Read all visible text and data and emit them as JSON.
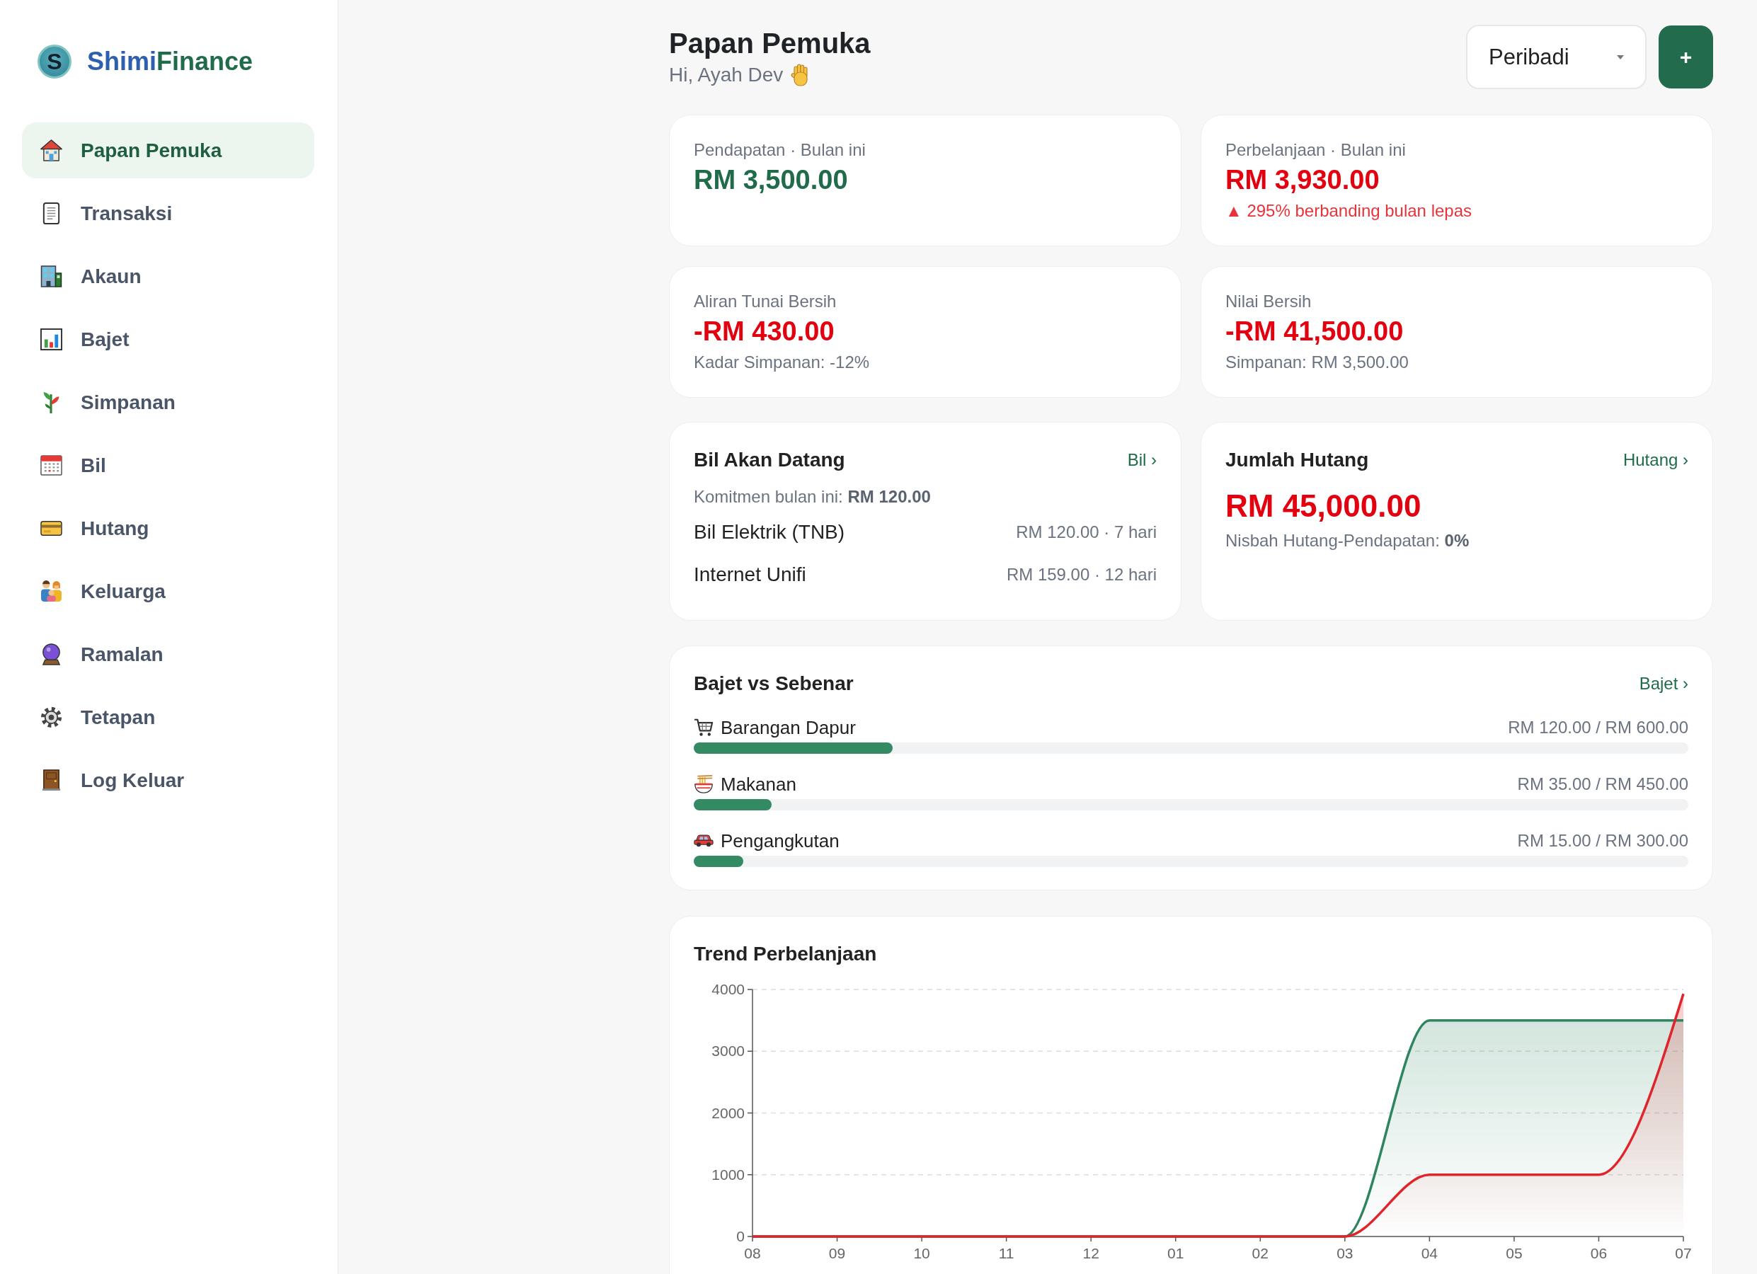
{
  "sidebar": {
    "brand": {
      "mark": "S",
      "name_start": "Shimi",
      "name_end": "Finance"
    },
    "items": [
      {
        "label": "Papan Pemuka",
        "selected": true
      },
      {
        "label": "Transaksi",
        "selected": false
      },
      {
        "label": "Akaun",
        "selected": false
      },
      {
        "label": "Bajet",
        "selected": false
      },
      {
        "label": "Simpanan",
        "selected": false
      },
      {
        "label": "Bil",
        "selected": false
      },
      {
        "label": "Hutang",
        "selected": false
      },
      {
        "label": "Keluarga",
        "selected": false
      },
      {
        "label": "Ramalan",
        "selected": false
      },
      {
        "label": "Tetapan",
        "selected": false
      },
      {
        "label": "Log Keluar",
        "selected": false
      }
    ]
  },
  "header": {
    "title": "Papan Pemuka",
    "greeting": "Hi, Ayah Dev",
    "profile_select": {
      "value": "Peribadi"
    },
    "add_button": "+"
  },
  "stat_cards": [
    {
      "label": "Pendapatan · Bulan ini",
      "value": "RM 3,500.00",
      "color": "#1f6b4a"
    },
    {
      "label": "Perbelanjaan · Bulan ini",
      "value": "RM 3,930.00",
      "color": "#e3000f",
      "note": {
        "text": "▲ 295% berbanding bulan lepas",
        "color": "#e8333a"
      }
    },
    {
      "label": "Aliran Tunai Bersih",
      "value": "-RM 430.00",
      "color": "#e3000f",
      "note": {
        "text": "Kadar Simpanan: -12%",
        "color": "#6b7280"
      }
    },
    {
      "label": "Nilai Bersih",
      "value": "-RM 41,500.00",
      "color": "#e3000f",
      "note": {
        "text": "Simpanan: RM 3,500.00",
        "color": "#6b7280"
      }
    }
  ],
  "upcoming_bills": {
    "title": "Bil Akan Datang",
    "link": "Bil ›",
    "summary": "Komitmen bulan ini: **RM 120.00**",
    "items": [
      {
        "name": "Bil Elektrik (TNB)",
        "detail": "RM 120.00 · 7 hari"
      },
      {
        "name": "Internet Unifi",
        "detail": "RM 159.00 · 12 hari"
      }
    ]
  },
  "total_debt": {
    "title": "Jumlah Hutang",
    "link": "Hutang ›",
    "amount": "RM 45,000.00",
    "ratio": "Nisbah Hutang-Pendapatan: **0%**"
  },
  "budget": {
    "title": "Bajet vs Sebenar",
    "link": "Bajet ›",
    "items": [
      {
        "name": "Barangan Dapur",
        "amount": "RM 120.00 / RM 600.00",
        "level": 0.2
      },
      {
        "name": "Makanan",
        "amount": "RM 35.00 / RM 450.00",
        "level": 0.078
      },
      {
        "name": "Pengangkutan",
        "amount": "RM 15.00 / RM 300.00",
        "level": 0.05
      }
    ]
  },
  "spending_trend": {
    "title": "Trend Perbelanjaan",
    "chart_data": {
      "type": "area",
      "categories": [
        "08",
        "09",
        "10",
        "11",
        "12",
        "01",
        "02",
        "03",
        "04",
        "05",
        "06",
        "07"
      ],
      "series": [
        {
          "color": "#2e8560",
          "values": [
            0,
            0,
            0,
            0,
            0,
            0,
            0,
            0,
            3500,
            3500,
            3500,
            3500
          ]
        },
        {
          "color": "#e0242b",
          "values": [
            0,
            0,
            0,
            0,
            0,
            0,
            0,
            0,
            1000,
            1000,
            1000,
            3930
          ]
        }
      ],
      "ylim": [
        0,
        4000
      ],
      "yticks": [
        0,
        1000,
        2000,
        3000,
        4000
      ],
      "grid": true
    }
  }
}
